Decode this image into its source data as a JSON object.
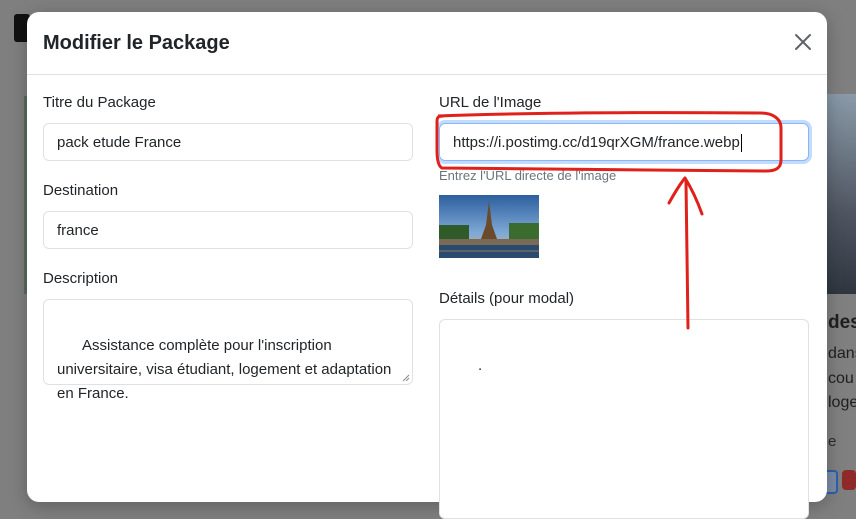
{
  "modal": {
    "title": "Modifier le Package",
    "close_icon": "close-icon"
  },
  "form": {
    "titre": {
      "label": "Titre du Package",
      "value": "pack etude France"
    },
    "destination": {
      "label": "Destination",
      "value": "france"
    },
    "description": {
      "label": "Description",
      "value": "Assistance complète pour l'inscription universitaire, visa étudiant, logement et adaptation en France."
    },
    "image_url": {
      "label": "URL de l'Image",
      "value": "https://i.postimg.cc/d19qrXGM/france.webp",
      "help": "Entrez l'URL directe de l'image"
    },
    "details": {
      "label": "Détails (pour modal)",
      "value": "."
    }
  },
  "background": {
    "card_title": "des",
    "card_line1": "dans",
    "card_line2": "cou",
    "card_line3": "loge",
    "card_price": "e"
  },
  "colors": {
    "annotation": "#e0201b",
    "focus_border": "#86b7fe"
  }
}
